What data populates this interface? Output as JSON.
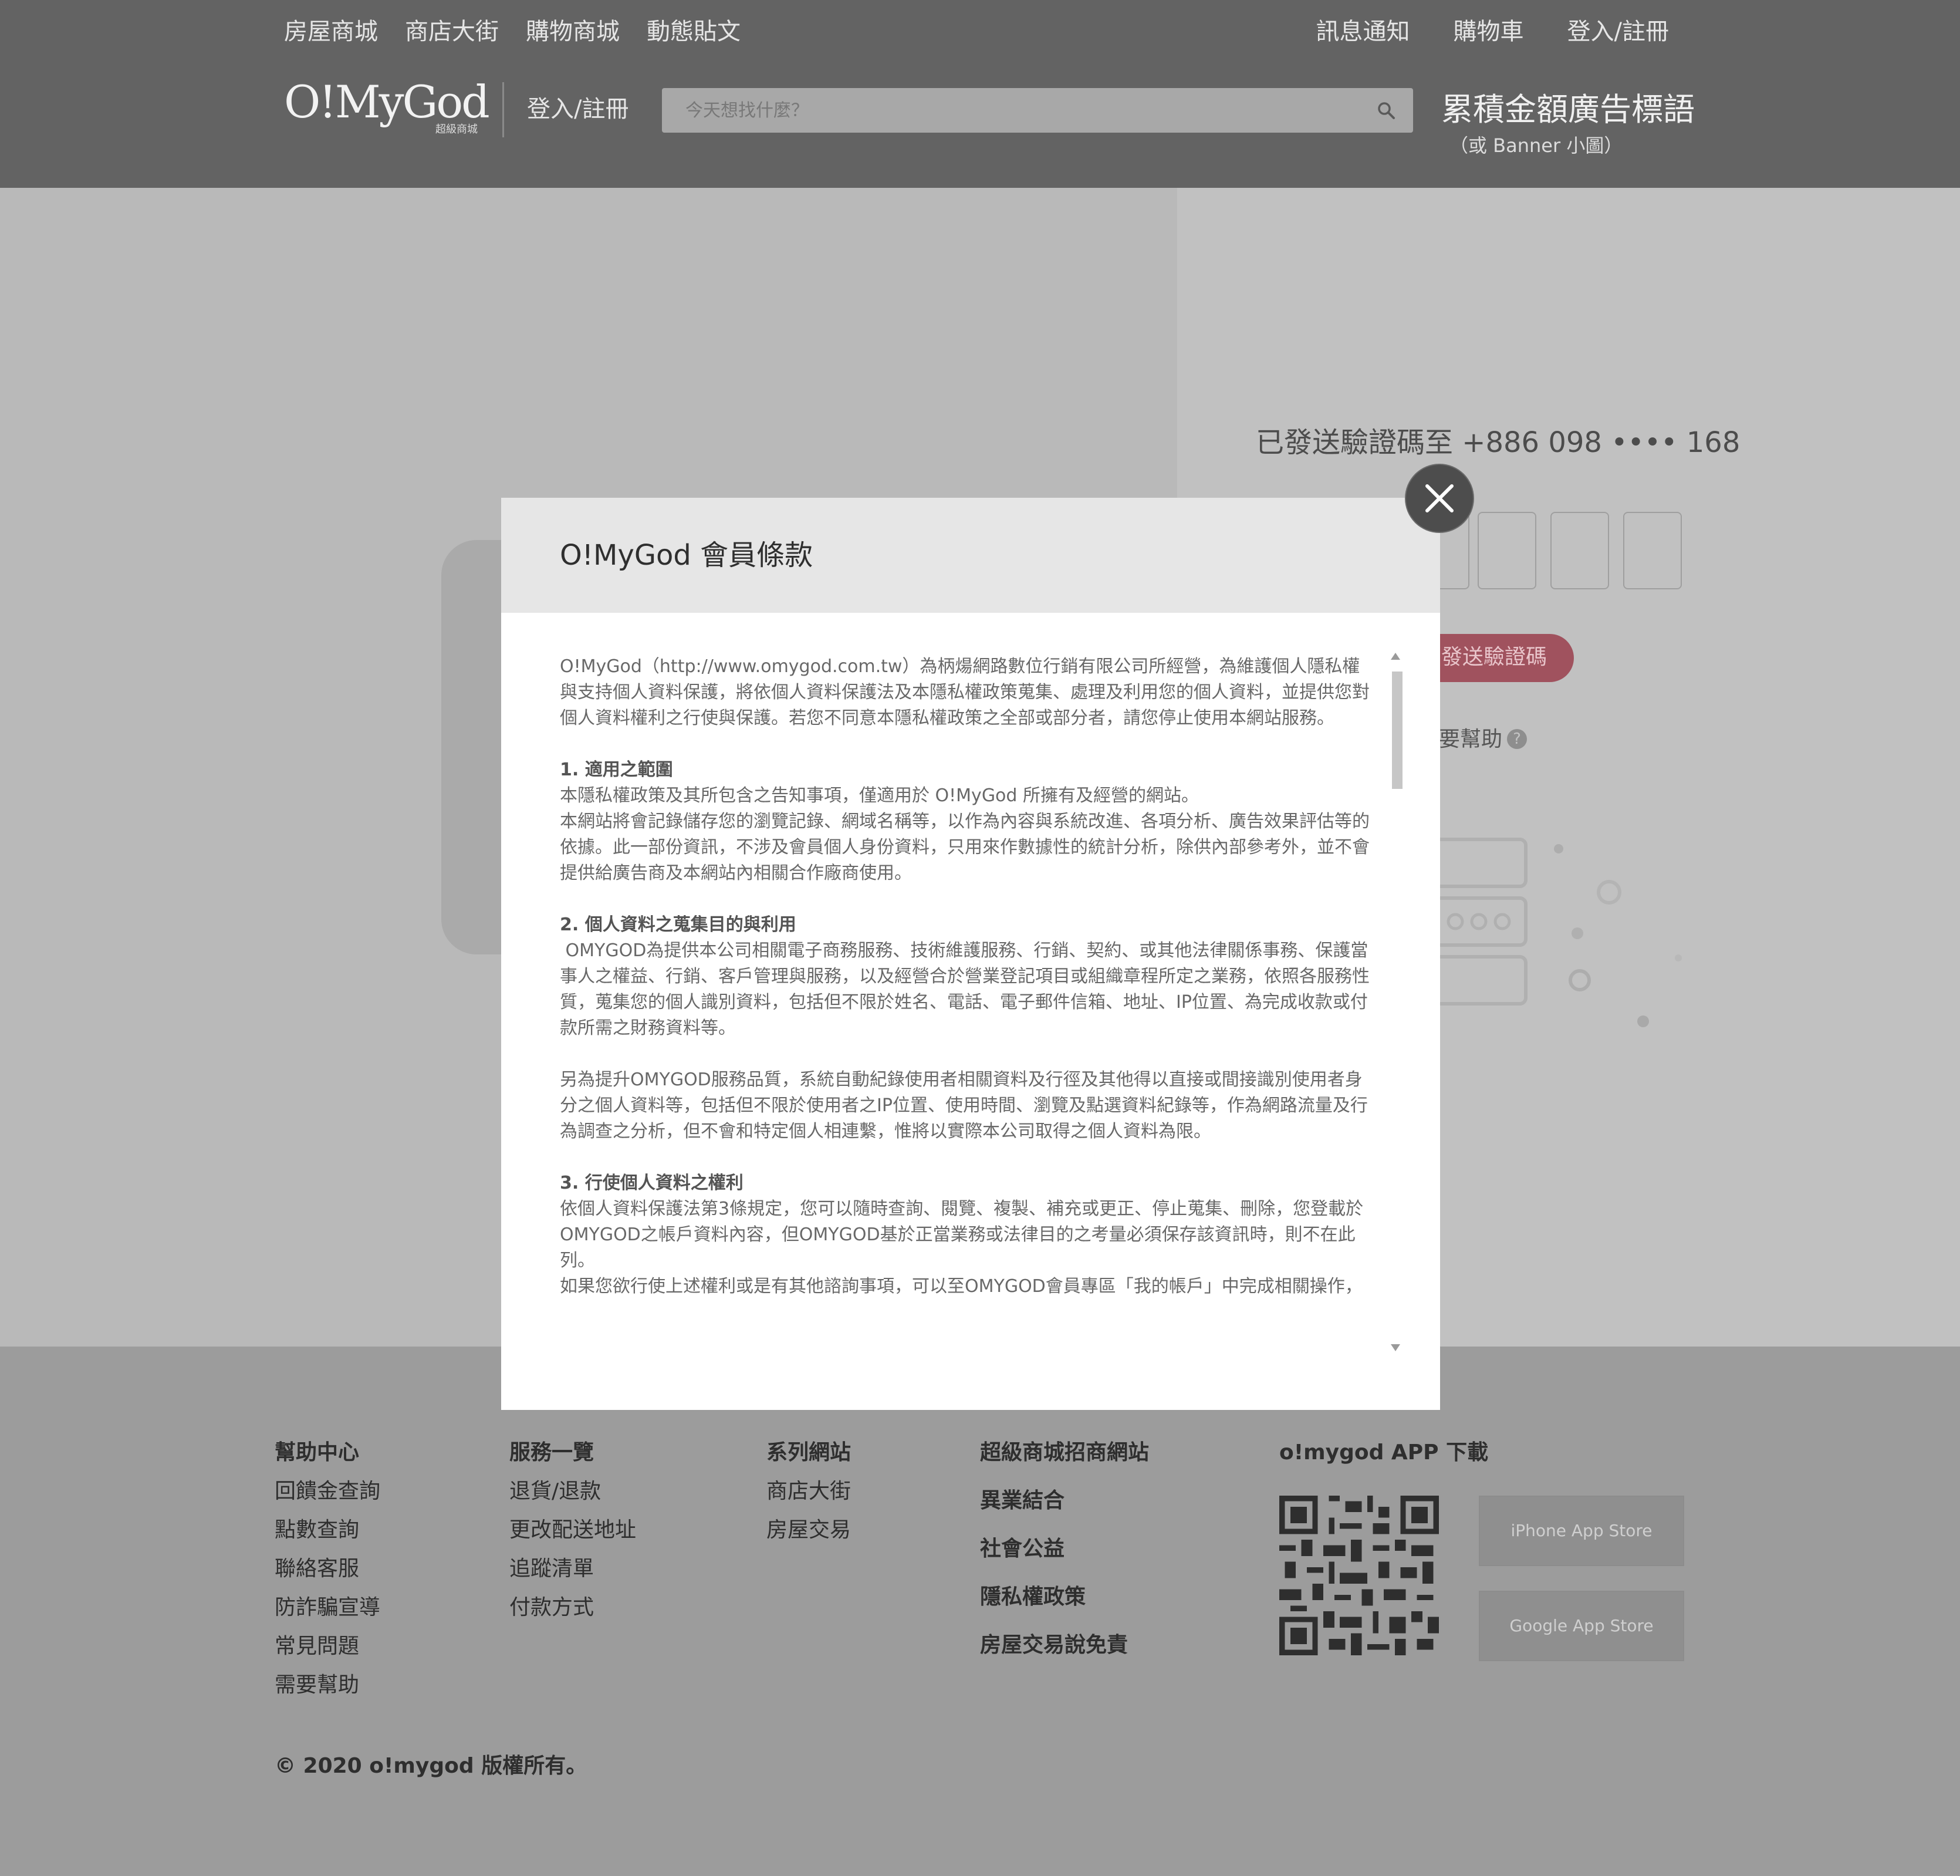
{
  "header": {
    "top_nav_left": [
      "房屋商城",
      "商店大街",
      "購物商城",
      "動態貼文"
    ],
    "top_nav_right": [
      "訊息通知",
      "購物車",
      "登入/註冊"
    ],
    "logo_main": "O!MyGod",
    "logo_sub": "超級商城",
    "login_register": "登入/註冊",
    "search_placeholder": "今天想找什麼？",
    "ad_title": "累積金額廣告標語",
    "ad_subtitle": "（或 Banner 小圖）"
  },
  "verify": {
    "sent_text": "已發送驗證碼至 +886 098 •••• 168",
    "resend_label": "發送驗證碼",
    "help_label": "要幫助",
    "help_icon": "?"
  },
  "modal": {
    "title": "O!MyGod 會員條款",
    "intro": "O!MyGod（http://www.omygod.com.tw）為柄煬網路數位行銷有限公司所經營，為維護個人隱私權與支持個人資料保護，將依個人資料保護法及本隱私權政策蒐集、處理及利用您的個人資料，並提供您對個人資料權利之行使與保護。若您不同意本隱私權政策之全部或部分者，請您停止使用本網站服務。",
    "section1_title": "1. 適用之範圍",
    "section1_p1": "本隱私權政策及其所包含之告知事項，僅適用於 O!MyGod 所擁有及經營的網站。",
    "section1_p2": "本網站將會記錄儲存您的瀏覽記錄、網域名稱等，以作為內容與系統改進、各項分析、廣告效果評估等的依據。此一部份資訊，不涉及會員個人身份資料，只用來作數據性的統計分析，除供內部參考外，並不會提供給廣告商及本網站內相關合作廠商使用。",
    "section2_title": "2. 個人資料之蒐集目的與利用",
    "section2_p1": " OMYGOD為提供本公司相關電子商務服務、技術維護服務、行銷、契約、或其他法律關係事務、保護當事人之權益、行銷、客戶管理與服務，以及經營合於營業登記項目或組織章程所定之業務，依照各服務性質，蒐集您的個人識別資料，包括但不限於姓名、電話、電子郵件信箱、地址、IP位置、為完成收款或付款所需之財務資料等。",
    "section2_p2": "另為提升OMYGOD服務品質，系統自動紀錄使用者相關資料及行徑及其他得以直接或間接識別使用者身分之個人資料等，包括但不限於使用者之IP位置、使用時間、瀏覽及點選資料紀錄等，作為網路流量及行為調查之分析，但不會和特定個人相連繫，惟將以實際本公司取得之個人資料為限。",
    "section3_title": "3. 行使個人資料之權利",
    "section3_p1": "依個人資料保護法第3條規定，您可以隨時查詢、閱覽、複製、補充或更正、停止蒐集、刪除，您登載於OMYGOD之帳戶資料內容，但OMYGOD基於正當業務或法律目的之考量必須保存該資訊時，則不在此列。",
    "section3_p2": "如果您欲行使上述權利或是有其他諮詢事項，可以至OMYGOD會員專區「我的帳戶」中完成相關操作，或逕由客服中心聯絡客服提出意見，我們將盡快回覆您的問題。"
  },
  "footer": {
    "help": {
      "title": "幫助中心",
      "items": [
        "回饋金查詢",
        "點數查詢",
        "聯絡客服",
        "防詐騙宣導",
        "常見問題",
        "需要幫助"
      ]
    },
    "service": {
      "title": "服務一覽",
      "items": [
        "退貨/退款",
        "更改配送地址",
        "追蹤清單",
        "付款方式"
      ]
    },
    "sites": {
      "title": "系列網站",
      "items": [
        "商店大街",
        "房屋交易"
      ]
    },
    "links": {
      "title": "超級商城招商網站",
      "items": [
        "異業結合",
        "社會公益",
        "隱私權政策",
        "房屋交易說免責"
      ]
    },
    "app": {
      "title": "o!mygod APP 下載",
      "iphone": "iPhone App Store",
      "google": "Google App Store"
    },
    "copyright": "© 2020 o!mygod 版權所有。"
  },
  "colors": {
    "header_bg": "#636363",
    "overlay_bg": "#b9b9b9",
    "modal_head_bg": "#e6e6e6",
    "accent_pink": "#a0525e",
    "footer_bg": "#9c9c9c"
  }
}
